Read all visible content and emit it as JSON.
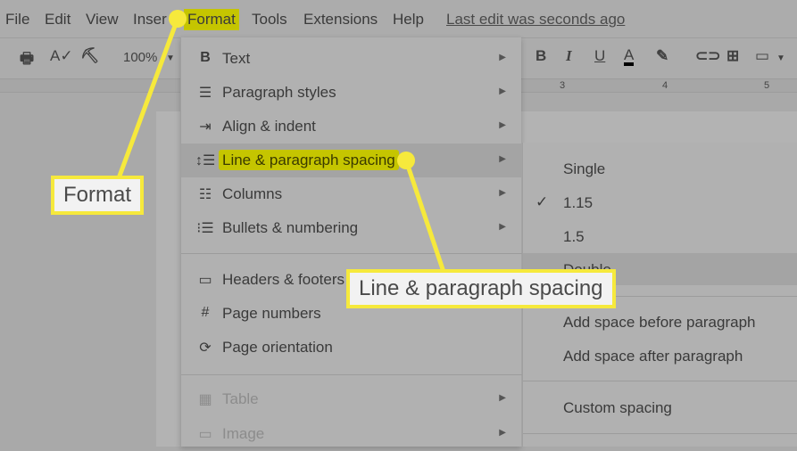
{
  "menubar": {
    "items": [
      "File",
      "Edit",
      "View",
      "Inser",
      "Format",
      "Tools",
      "Extensions",
      "Help"
    ],
    "last_edit": "Last edit was seconds ago"
  },
  "toolbar": {
    "zoom": "100%"
  },
  "ruler": {
    "marks": [
      "3",
      "4",
      "5"
    ]
  },
  "format_menu": {
    "items": [
      {
        "label": "Text",
        "icon": "bold-icon"
      },
      {
        "label": "Paragraph styles",
        "icon": "paragraph-icon"
      },
      {
        "label": "Align & indent",
        "icon": "indent-icon"
      },
      {
        "label": "Line & paragraph spacing",
        "icon": "line-spacing-icon"
      },
      {
        "label": "Columns",
        "icon": "columns-icon"
      },
      {
        "label": "Bullets & numbering",
        "icon": "bullets-icon"
      },
      {
        "label": "Headers & footers",
        "icon": "header-footer-icon"
      },
      {
        "label": "Page numbers",
        "icon": "hash-icon"
      },
      {
        "label": "Page orientation",
        "icon": "page-orientation-icon"
      },
      {
        "label": "Table",
        "icon": "table-icon"
      },
      {
        "label": "Image",
        "icon": "image-icon"
      }
    ]
  },
  "spacing_submenu": {
    "items": [
      "Single",
      "1.15",
      "1.5",
      "Double",
      "Add space before paragraph",
      "Add space after paragraph",
      "Custom spacing"
    ],
    "checked": "1.15"
  },
  "callouts": {
    "format": "Format",
    "spacing": "Line & paragraph spacing"
  },
  "colors": {
    "highlight": "#c5c500",
    "callout_border": "#f6e93c"
  }
}
